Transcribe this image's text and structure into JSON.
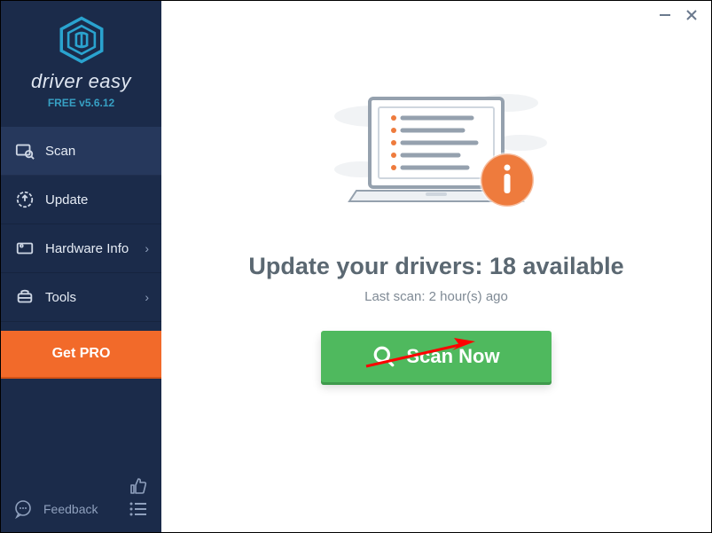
{
  "brand": {
    "name": "driver easy",
    "version": "FREE v5.6.12"
  },
  "sidebar": {
    "items": [
      {
        "label": "Scan",
        "icon": "scan-icon",
        "has_submenu": false
      },
      {
        "label": "Update",
        "icon": "update-icon",
        "has_submenu": false
      },
      {
        "label": "Hardware Info",
        "icon": "hardware-icon",
        "has_submenu": true
      },
      {
        "label": "Tools",
        "icon": "tools-icon",
        "has_submenu": true
      }
    ],
    "get_pro_label": "Get PRO",
    "feedback_label": "Feedback"
  },
  "main": {
    "headline_prefix": "Update your drivers: ",
    "headline_count": "18",
    "headline_suffix": " available",
    "last_scan": "Last scan: 2 hour(s) ago",
    "scan_button_label": "Scan Now"
  },
  "colors": {
    "sidebar_bg": "#1b2b4a",
    "accent_orange": "#f26a2a",
    "accent_green": "#4fb95e",
    "accent_cyan": "#37a0c4",
    "illustration_orange": "#ee7b3d"
  }
}
